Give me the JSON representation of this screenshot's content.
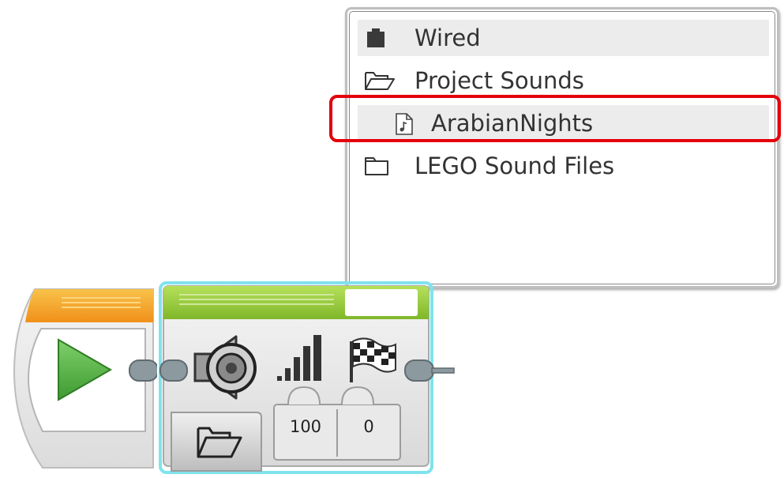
{
  "dropdown": {
    "items": [
      {
        "label": "Wired",
        "icon": "wired-port-icon",
        "highlighted": true
      },
      {
        "label": "Project Sounds",
        "icon": "folder-open-icon",
        "highlighted": false
      },
      {
        "label": "ArabianNights",
        "icon": "sound-file-icon",
        "highlighted": true,
        "selected": true
      },
      {
        "label": "LEGO Sound Files",
        "icon": "folder-closed-icon",
        "highlighted": false
      }
    ],
    "selection_outline_color": "#e3000b"
  },
  "blocks": {
    "start": {
      "icon": "play-start-icon",
      "header_color": "#f29a1d",
      "play_color": "#5cb84a"
    },
    "sound": {
      "header_color": "#8cc63f",
      "icon": "speaker-icon",
      "volume_icon": "volume-bars-icon",
      "play_type_icon": "checkered-flag-icon",
      "mode_icon": "folder-open-icon",
      "volume_value": "100",
      "play_type_value": "0"
    }
  }
}
